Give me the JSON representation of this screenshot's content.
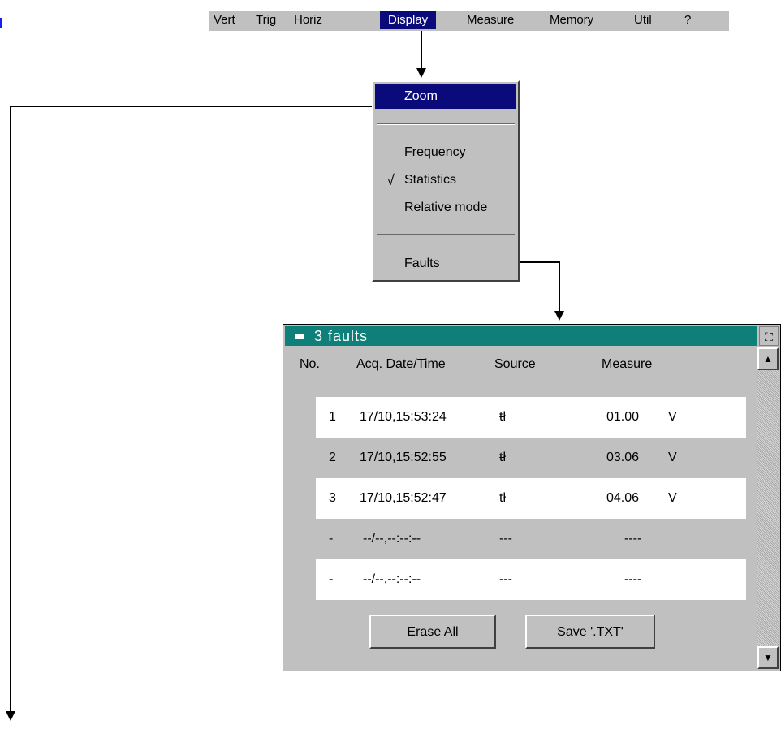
{
  "menubar": {
    "items": [
      {
        "label": "Vert",
        "selected": false
      },
      {
        "label": "Trig",
        "selected": false
      },
      {
        "label": "Horiz",
        "selected": false
      },
      {
        "label": "Display",
        "selected": true
      },
      {
        "label": "Measure",
        "selected": false
      },
      {
        "label": "Memory",
        "selected": false
      },
      {
        "label": "Util",
        "selected": false
      },
      {
        "label": "?",
        "selected": false
      }
    ]
  },
  "dropdown": {
    "items": [
      {
        "label": "Zoom",
        "selected": true,
        "checked": false
      },
      {
        "label": "Frequency",
        "selected": false,
        "checked": false
      },
      {
        "label": "Statistics",
        "selected": false,
        "checked": true
      },
      {
        "label": "Relative mode",
        "selected": false,
        "checked": false
      },
      {
        "label": "Faults",
        "selected": false,
        "checked": false
      }
    ],
    "check_glyph": "√"
  },
  "faults_window": {
    "title": "3 faults",
    "columns": [
      "No.",
      "Acq. Date/Time",
      "Source",
      "Measure"
    ],
    "rows": [
      {
        "no": "1",
        "datetime": "17/10,15:53:24",
        "source": "ŧł",
        "measure": "01.00",
        "unit": "V"
      },
      {
        "no": "2",
        "datetime": "17/10,15:52:55",
        "source": "ŧł",
        "measure": "03.06",
        "unit": "V"
      },
      {
        "no": "3",
        "datetime": "17/10,15:52:47",
        "source": "ŧł",
        "measure": "04.06",
        "unit": "V"
      },
      {
        "no": "-",
        "datetime": "--/--,--:--:--",
        "source": "---",
        "measure": "----",
        "unit": ""
      },
      {
        "no": "-",
        "datetime": "--/--,--:--:--",
        "source": "---",
        "measure": "----",
        "unit": ""
      }
    ],
    "buttons": {
      "erase": "Erase All",
      "save": "Save '.TXT'"
    }
  },
  "colors": {
    "menu_bg": "#c0c0c0",
    "selection": "#0a0a7a",
    "title_bar": "#0f7f7a"
  }
}
